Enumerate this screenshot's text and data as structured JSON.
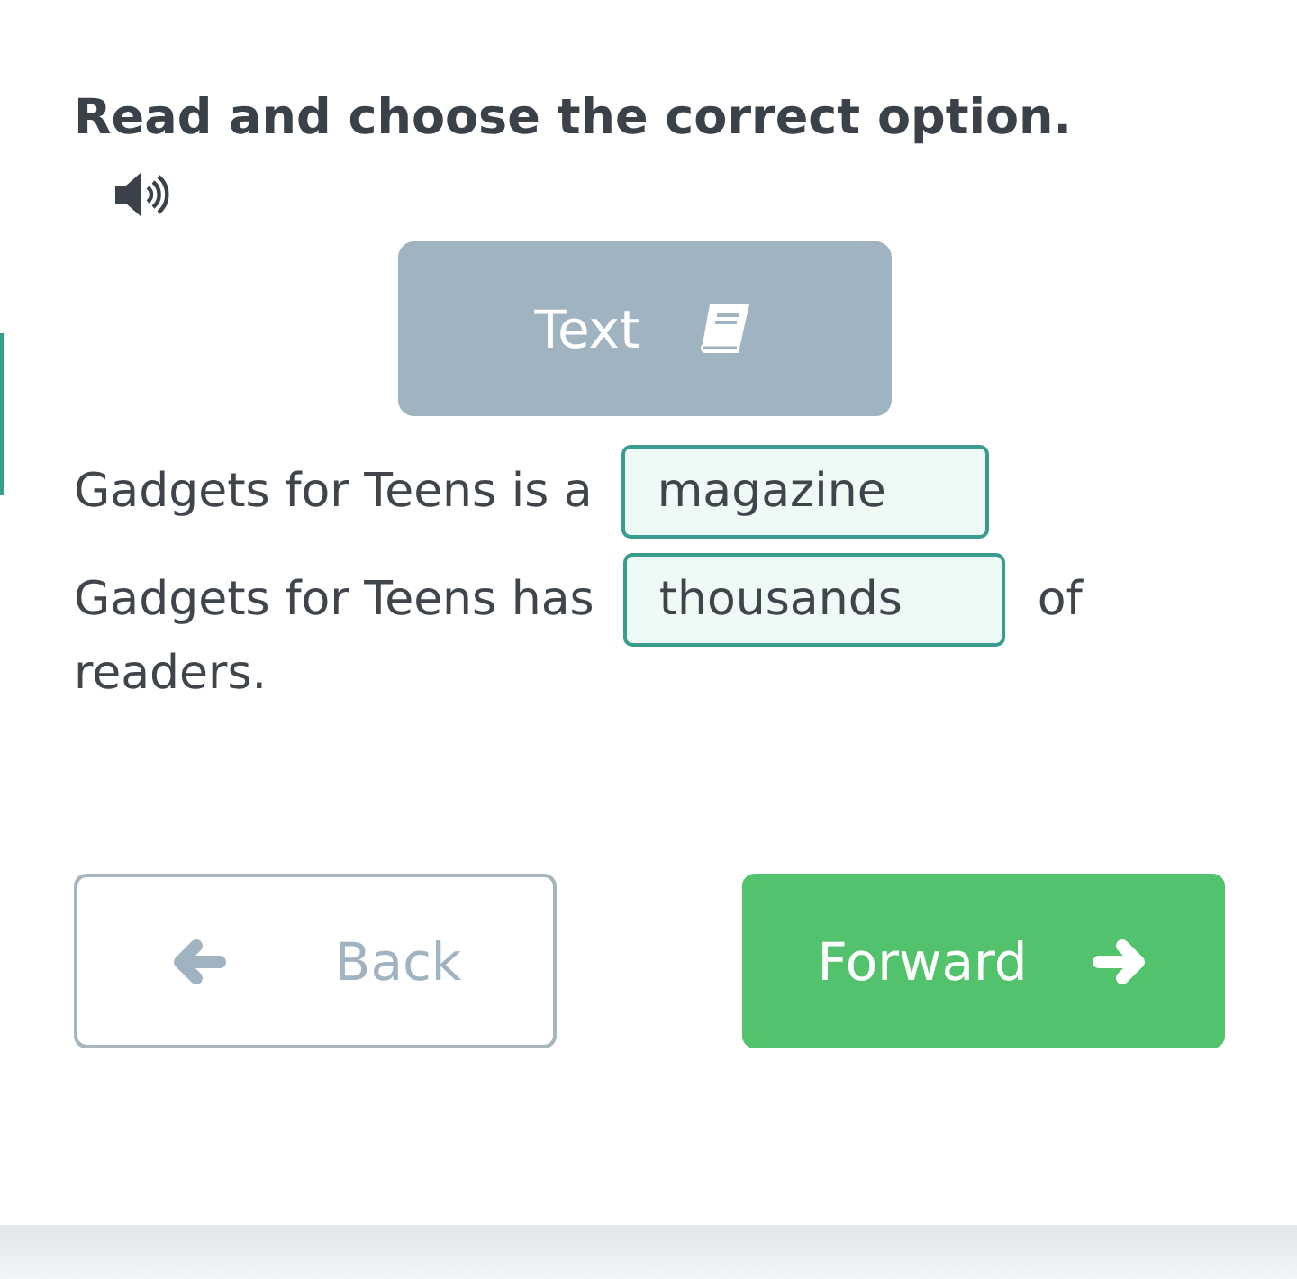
{
  "instruction": "Read and choose the correct option.",
  "text_button": {
    "label": "Text"
  },
  "sentences": [
    {
      "before": "Gadgets for Teens is a",
      "answer": "magazine"
    },
    {
      "before": "Gadgets for Teens has",
      "answer": "thousands",
      "after": "of",
      "continuation": "readers."
    }
  ],
  "nav": [
    {
      "kind": "back",
      "label": "Back",
      "disabled": true
    },
    {
      "kind": "forward",
      "label": "Forward",
      "disabled": false
    }
  ]
}
